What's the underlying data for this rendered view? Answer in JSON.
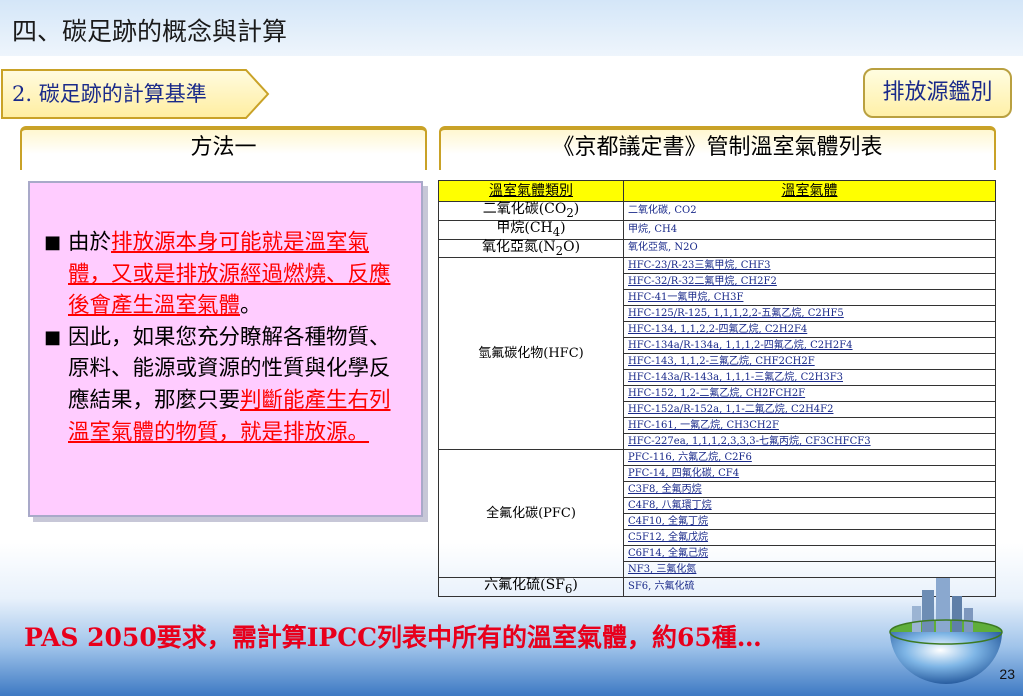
{
  "slide_title": "四、碳足跡的概念與計算",
  "section_tab": "2. 碳足跡的計算基準",
  "emission_button": "排放源鑑別",
  "left_banner": "方法一",
  "right_banner": "《京都議定書》管制溫室氣體列表",
  "panel": {
    "b1_pre": "由於",
    "b1_red": "排放源本身可能就是溫室氣體，又或是排放源經過燃燒、反應後會產生溫室氣體",
    "b1_post": "。",
    "b2_pre": "因此，如果您充分瞭解各種物質、原料、能源或資源的性質與化學反應結果，那麼只要",
    "b2_red": "判斷能產生右列溫室氣體的物質，就是排放源。"
  },
  "table": {
    "header_category": "溫室氣體類別",
    "header_gas": "溫室氣體",
    "co2_cat": "二氧化碳(CO",
    "co2_sub": "2",
    "co2_close": ")",
    "co2_gas": "二氧化碳, CO2",
    "ch4_cat": "甲烷(CH",
    "ch4_sub": "4",
    "ch4_close": ")",
    "ch4_gas": "甲烷, CH4",
    "n2o_cat_a": "氧化亞氮(N",
    "n2o_sub": "2",
    "n2o_cat_b": "O)",
    "n2o_gas": "氧化亞氮, N2O",
    "hfc_cat": "氫氟碳化物(HFC)",
    "hfc_gases": [
      "HFC-23/R-23三氟甲烷, CHF3",
      "HFC-32/R-32二氟甲烷, CH2F2",
      "HFC-41一氟甲烷, CH3F",
      "HFC-125/R-125, 1,1,1,2,2-五氟乙烷, C2HF5",
      "HFC-134, 1,1,2,2-四氟乙烷, C2H2F4",
      "HFC-134a/R-134a, 1,1,1,2-四氟乙烷, C2H2F4",
      "HFC-143, 1,1,2-三氟乙烷, CHF2CH2F",
      "HFC-143a/R-143a, 1,1,1-三氟乙烷, C2H3F3",
      "HFC-152, 1,2-二氟乙烷, CH2FCH2F",
      "HFC-152a/R-152a, 1,1-二氟乙烷, C2H4F2",
      "HFC-161, 一氟乙烷, CH3CH2F",
      "HFC-227ea, 1,1,1,2,3,3,3-七氟丙烷, CF3CHFCF3"
    ],
    "pfc_cat": "全氟化碳(PFC)",
    "pfc_gases": [
      "PFC-116, 六氟乙烷, C2F6",
      "PFC-14, 四氟化碳, CF4",
      "C3F8, 全氟丙烷",
      "C4F8, 八氟環丁烷",
      "C4F10, 全氟丁烷",
      "C5F12, 全氟戊烷",
      "C6F14, 全氟己烷",
      "NF3, 三氟化氮"
    ],
    "sf6_cat": "六氟化硫(SF",
    "sf6_sub": "6",
    "sf6_close": ")",
    "sf6_gas": "SF6, 六氟化硫"
  },
  "bottom_text": "PAS 2050要求，需計算IPCC列表中所有的溫室氣體，約65種…",
  "page_number": "23"
}
